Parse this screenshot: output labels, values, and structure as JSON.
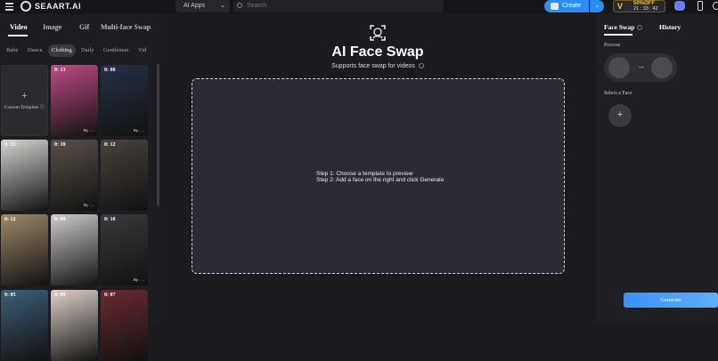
{
  "header": {
    "logo_text": "SEAART.AI",
    "apps_select": "AI Apps",
    "search_placeholder": "Search",
    "create_label": "Create",
    "promo_percent": "50%OFF",
    "promo_timer": "21 : 33 : 42"
  },
  "left": {
    "tabs": [
      {
        "label": "Video"
      },
      {
        "label": "Image"
      },
      {
        "label": "Gif"
      },
      {
        "label": "Multi-face Swap"
      }
    ],
    "chips": [
      {
        "label": "Babe"
      },
      {
        "label": "Dance"
      },
      {
        "label": "Clothing"
      },
      {
        "label": "Daily"
      },
      {
        "label": "Gentleman"
      },
      {
        "label": "Vid"
      }
    ],
    "custom_template_label": "Custom Template",
    "cards": [
      {
        "duration": "0: 13",
        "by": "By : ...",
        "color": "#c04a86"
      },
      {
        "duration": "0: 08",
        "by": "By : ...",
        "color": "#243048"
      },
      {
        "duration": "0: 35",
        "by": "",
        "color": "#d9d6d3"
      },
      {
        "duration": "0: 10",
        "by": "By : ...",
        "color": "#5a5048"
      },
      {
        "duration": "0: 12",
        "by": "",
        "color": "#4a423d"
      },
      {
        "duration": "0: 12",
        "by": "",
        "color": "#a08a68"
      },
      {
        "duration": "0: 09",
        "by": "",
        "color": "#cdcbca"
      },
      {
        "duration": "0: 10",
        "by": "By : ...",
        "color": "#3a3a3e"
      },
      {
        "duration": "0: 05",
        "by": "",
        "color": "#3c5f78"
      },
      {
        "duration": "0: 09",
        "by": "",
        "color": "#e0d2c8"
      },
      {
        "duration": "0: 07",
        "by": "",
        "color": "#6a2a30"
      }
    ]
  },
  "main": {
    "title": "AI Face Swap",
    "subtitle": "Supports face swap for videos",
    "step1": "Step 1: Choose a template to preview",
    "step2": "Step 2: Add a face on the right and click Generate"
  },
  "right": {
    "tab_face_swap": "Face Swap",
    "tab_history": "History",
    "process_label": "Process",
    "select_face_label": "Select a Face",
    "generate_label": "Generate"
  },
  "colors": {
    "accent": "#2b8ef6",
    "panel": "#1e1e24",
    "background": "#1a1a1f"
  }
}
